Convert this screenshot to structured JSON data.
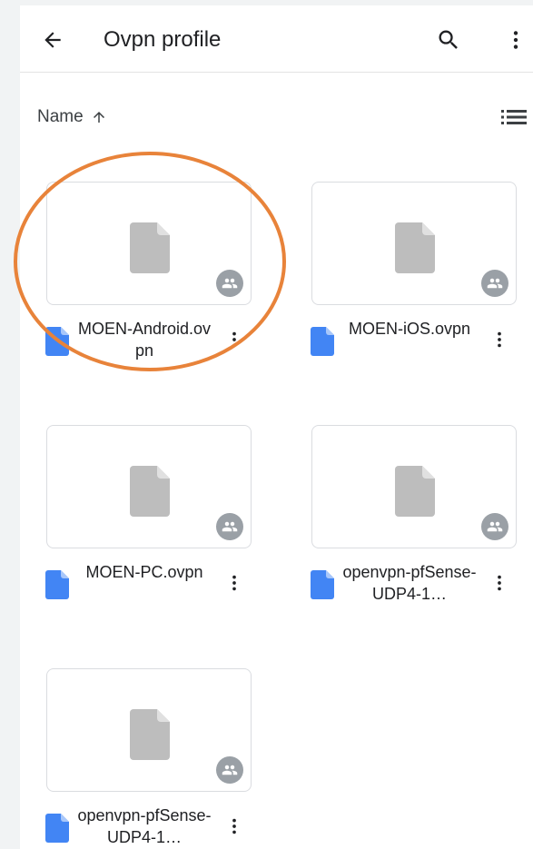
{
  "appbar": {
    "title": "Ovpn profile",
    "back_icon": "arrow-back-icon",
    "search_icon": "search-icon",
    "more_icon": "more-vert-icon"
  },
  "sort": {
    "label": "Name",
    "direction_icon": "arrow-up-icon",
    "view_icon": "list-view-icon"
  },
  "files": [
    {
      "name": "MOEN-Android.ovpn",
      "shared": true
    },
    {
      "name": "MOEN-iOS.ovpn",
      "shared": true
    },
    {
      "name": "MOEN-PC.ovpn",
      "shared": true
    },
    {
      "name": "openvpn-pfSense-UDP4-1…",
      "shared": true
    },
    {
      "name": "openvpn-pfSense-UDP4-1…",
      "shared": true
    }
  ],
  "colors": {
    "file_icon": "#4285f4",
    "placeholder": "#bdbdbd",
    "shared_badge": "#9aa0a6",
    "annotation": "#e8833a"
  }
}
